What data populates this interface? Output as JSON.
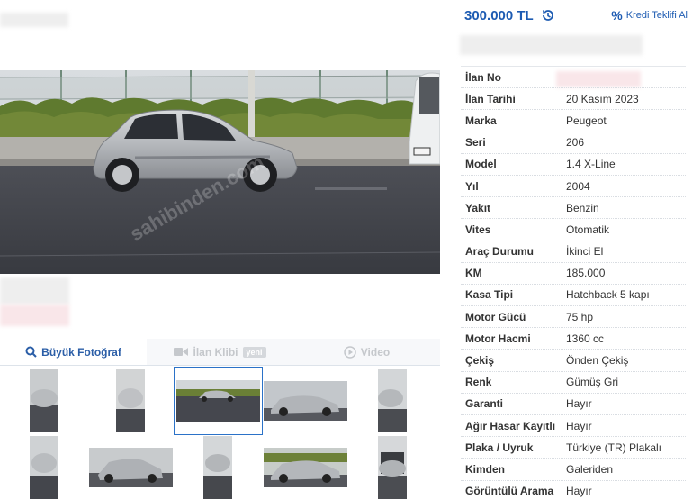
{
  "listing": {
    "price": "300.000 TL",
    "kredi_label": "Kredi Teklifi Al",
    "kredi_icon": "percent-icon",
    "history_icon": "history-icon"
  },
  "media_tabs": [
    {
      "label": "Büyük Fotoğraf",
      "icon": "search-icon",
      "active": true
    },
    {
      "label": "İlan Klibi",
      "icon": "video-camera-icon",
      "badge": "yeni",
      "active": false
    },
    {
      "label": "Video",
      "icon": "play-icon",
      "active": false
    }
  ],
  "watermark": "sahibinden.com",
  "details": [
    {
      "key": "İlan No",
      "value": ""
    },
    {
      "key": "İlan Tarihi",
      "value": "20 Kasım 2023"
    },
    {
      "key": "Marka",
      "value": "Peugeot"
    },
    {
      "key": "Seri",
      "value": "206"
    },
    {
      "key": "Model",
      "value": "1.4 X-Line"
    },
    {
      "key": "Yıl",
      "value": "2004"
    },
    {
      "key": "Yakıt",
      "value": "Benzin"
    },
    {
      "key": "Vites",
      "value": "Otomatik"
    },
    {
      "key": "Araç Durumu",
      "value": "İkinci El"
    },
    {
      "key": "KM",
      "value": "185.000"
    },
    {
      "key": "Kasa Tipi",
      "value": "Hatchback 5 kapı"
    },
    {
      "key": "Motor Gücü",
      "value": "75 hp"
    },
    {
      "key": "Motor Hacmi",
      "value": "1360 cc"
    },
    {
      "key": "Çekiş",
      "value": "Önden Çekiş"
    },
    {
      "key": "Renk",
      "value": "Gümüş Gri"
    },
    {
      "key": "Garanti",
      "value": "Hayır"
    },
    {
      "key": "Ağır Hasar Kayıtlı",
      "value": "Hayır"
    },
    {
      "key": "Plaka / Uyruk",
      "value": "Türkiye (TR) Plakalı"
    },
    {
      "key": "Kimden",
      "value": "Galeriden"
    },
    {
      "key": "Görüntülü Arama",
      "value": "Hayır"
    }
  ]
}
